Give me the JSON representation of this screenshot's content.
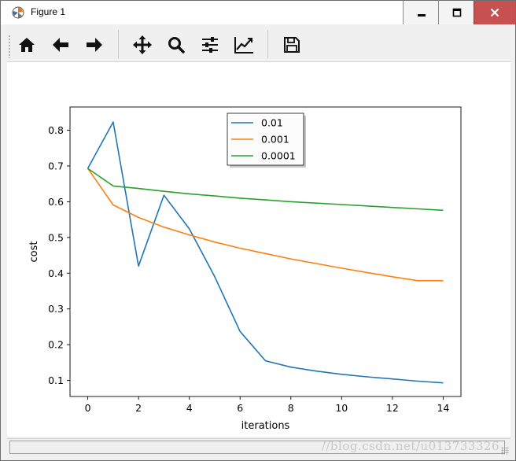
{
  "window": {
    "title": "Figure 1",
    "minimize_icon": "minimize-icon",
    "maximize_icon": "maximize-icon",
    "close_icon": "close-icon"
  },
  "toolbar": {
    "buttons": [
      {
        "name": "home",
        "icon": "home-icon"
      },
      {
        "name": "back",
        "icon": "arrow-left-icon"
      },
      {
        "name": "forward",
        "icon": "arrow-right-icon"
      },
      {
        "name": "pan",
        "icon": "move-icon"
      },
      {
        "name": "zoom",
        "icon": "magnifier-icon"
      },
      {
        "name": "configure-subplots",
        "icon": "sliders-icon"
      },
      {
        "name": "edit-axis",
        "icon": "line-chart-icon"
      },
      {
        "name": "save",
        "icon": "floppy-disk-icon"
      }
    ]
  },
  "statusbar": {
    "watermark": "//blog.csdn.net/u013733326"
  },
  "chart_data": {
    "type": "line",
    "title": "",
    "xlabel": "iterations",
    "ylabel": "cost",
    "xlim": [
      -0.7,
      14.7
    ],
    "ylim": [
      0.055,
      0.865
    ],
    "xticks": [
      0,
      2,
      4,
      6,
      8,
      10,
      12,
      14
    ],
    "yticks": [
      0.1,
      0.2,
      0.3,
      0.4,
      0.5,
      0.6,
      0.7,
      0.8
    ],
    "ytick_labels": [
      "0.1",
      "0.2",
      "0.3",
      "0.4",
      "0.5",
      "0.6",
      "0.7",
      "0.8"
    ],
    "grid": false,
    "legend_position": "upper-center",
    "x": [
      0,
      1,
      2,
      3,
      4,
      5,
      6,
      7,
      8,
      9,
      10,
      11,
      12,
      13,
      14
    ],
    "series": [
      {
        "name": "0.01",
        "color": "#1f77b4",
        "values": [
          0.693,
          0.823,
          0.42,
          0.618,
          0.524,
          0.39,
          0.237,
          0.155,
          0.137,
          0.126,
          0.117,
          0.11,
          0.104,
          0.098,
          0.093
        ]
      },
      {
        "name": "0.001",
        "color": "#ff7f0e",
        "values": [
          0.693,
          0.591,
          0.556,
          0.529,
          0.507,
          0.487,
          0.47,
          0.455,
          0.44,
          0.427,
          0.414,
          0.402,
          0.39,
          0.379,
          0.379
        ]
      },
      {
        "name": "0.0001",
        "color": "#2ca02c",
        "values": [
          0.693,
          0.644,
          0.637,
          0.629,
          0.622,
          0.616,
          0.61,
          0.605,
          0.6,
          0.596,
          0.592,
          0.588,
          0.584,
          0.58,
          0.576
        ]
      }
    ]
  }
}
